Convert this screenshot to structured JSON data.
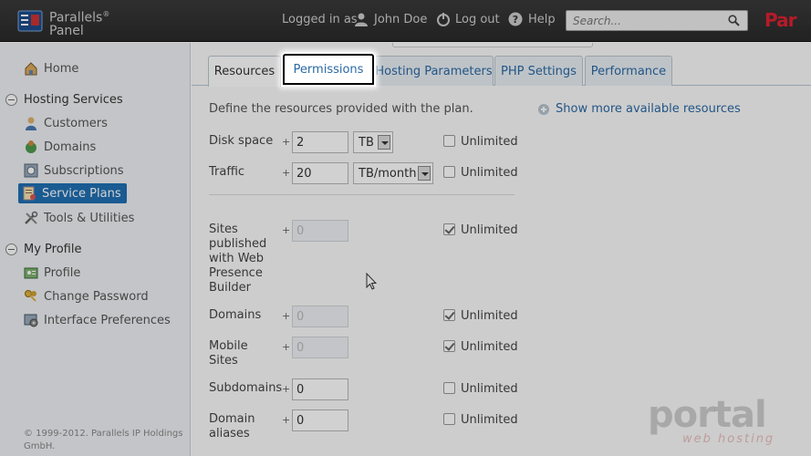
{
  "header": {
    "logo_line1": "Parallels",
    "logo_line2": "Panel",
    "logged_in_as": "Logged in as",
    "user_name": "John Doe",
    "logout": "Log out",
    "help": "Help",
    "search_placeholder": "Search...",
    "brand_right": "Par"
  },
  "sidebar": {
    "home": "Home",
    "hosting_services": "Hosting Services",
    "items": [
      {
        "label": "Customers"
      },
      {
        "label": "Domains"
      },
      {
        "label": "Subscriptions"
      },
      {
        "label": "Service Plans"
      },
      {
        "label": "Tools & Utilities"
      }
    ],
    "my_profile": "My Profile",
    "profile_items": [
      {
        "label": "Profile"
      },
      {
        "label": "Change Password"
      },
      {
        "label": "Interface Preferences"
      }
    ],
    "copyright": "© 1999-2012. Parallels IP Holdings GmbH."
  },
  "tabs": [
    {
      "label": "Resources"
    },
    {
      "label": "Permissions"
    },
    {
      "label": "Hosting Parameters"
    },
    {
      "label": "PHP Settings"
    },
    {
      "label": "Performance"
    }
  ],
  "content": {
    "intro": "Define the resources provided with the plan.",
    "show_more": "Show more available resources",
    "plus": "+",
    "unlimited": "Unlimited",
    "rows": [
      {
        "label": "Disk space",
        "value": "2",
        "unit": "TB",
        "unlimited": false,
        "disabled": false
      },
      {
        "label": "Traffic",
        "value": "20",
        "unit": "TB/month",
        "unlimited": false,
        "disabled": false
      },
      {
        "label": "Sites published with Web Presence Builder",
        "value": "0",
        "unlimited": true,
        "disabled": true
      },
      {
        "label": "Domains",
        "value": "0",
        "unlimited": true,
        "disabled": true
      },
      {
        "label": "Mobile Sites",
        "value": "0",
        "unlimited": true,
        "disabled": true
      },
      {
        "label": "Subdomains",
        "value": "0",
        "unlimited": false,
        "disabled": false
      },
      {
        "label": "Domain aliases",
        "value": "0",
        "unlimited": false,
        "disabled": false
      }
    ]
  },
  "watermark": {
    "main": "portal",
    "sub": "web hosting"
  },
  "colors": {
    "accent": "#1f6fb3",
    "header_bg": "#2f2f2f",
    "sidebar_bg": "#eef1f4",
    "link": "#2a6aa5"
  }
}
